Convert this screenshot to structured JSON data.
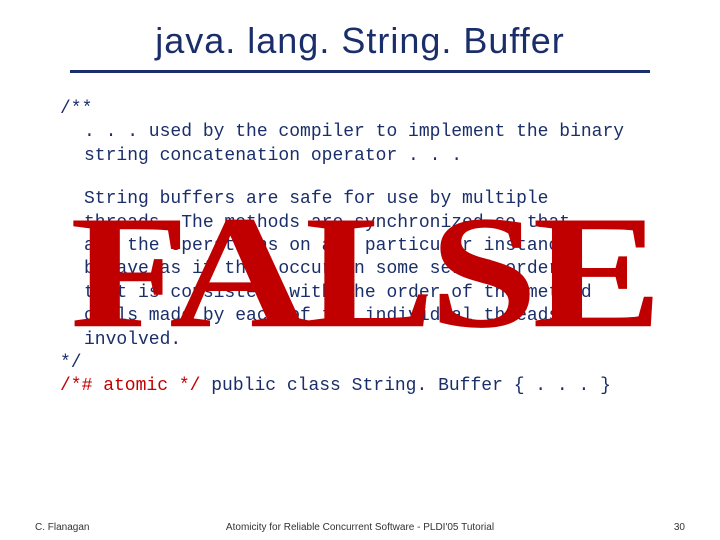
{
  "title": "java. lang. String. Buffer",
  "code": {
    "comment_open": "/**",
    "para1": ". . . used by the compiler to implement the binary\nstring concatenation operator . . .",
    "para2": "String buffers are safe for use by multiple\nthreads. The methods are synchronized so that\nall the operations on any particular instance\nbehave as if they occur in some serial order\nthat is consistent with the order of the method\ncalls made by each of the individual threads\ninvolved.",
    "comment_close": "*/",
    "atomic": "/*# atomic */",
    "class_decl": " public class String. Buffer { . . . }"
  },
  "overlay": "FALSE",
  "footer": {
    "left": "C. Flanagan",
    "center": "Atomicity for Reliable Concurrent Software - PLDI'05 Tutorial",
    "right": "30"
  }
}
